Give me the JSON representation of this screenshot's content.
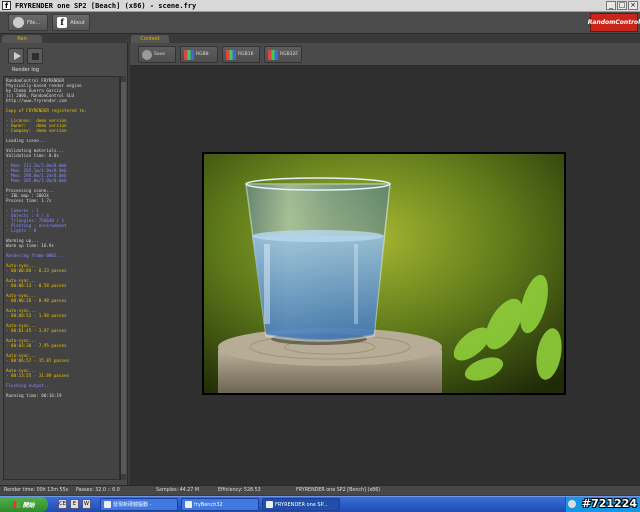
{
  "window": {
    "title": "FRYRENDER one SP2 [Beach] (x86) - scene.fry"
  },
  "toolbar": {
    "file_label": "File...",
    "about_label": "About",
    "brand": "RandomControl"
  },
  "left_tab": "Ren",
  "render_log_label": "Render log",
  "log_lines": [
    {
      "t": "RandomControl FRYRENDER",
      "c": "#d8d8d8"
    },
    {
      "t": "Physically-based render engine",
      "c": "#d8d8d8"
    },
    {
      "t": "by Chema Guerra Garcia",
      "c": "#d8d8d8"
    },
    {
      "t": "(c) 2006, RandomControl SLU",
      "c": "#d8d8d8"
    },
    {
      "t": "http://www.fryrender.com",
      "c": "#d8d8d8"
    },
    {
      "t": "",
      "c": "#d8d8d8"
    },
    {
      "t": "Copy of FRYRENDER registered to:",
      "c": "#e6c200"
    },
    {
      "t": "",
      "c": "#d8d8d8"
    },
    {
      "t": "- License:  demo version",
      "c": "#e6c200"
    },
    {
      "t": "- Owner:    demo version",
      "c": "#e6c200"
    },
    {
      "t": "- Company:  demo version",
      "c": "#e6c200"
    },
    {
      "t": "",
      "c": "#d8d8d8"
    },
    {
      "t": "Loading scene...",
      "c": "#d8d8d8"
    },
    {
      "t": "",
      "c": "#d8d8d8"
    },
    {
      "t": "Validating materials...",
      "c": "#d8d8d8"
    },
    {
      "t": "Validation time: 0.0s",
      "c": "#d8d8d8"
    },
    {
      "t": "",
      "c": "#d8d8d8"
    },
    {
      "t": "- Mem: 213.2m/3.0m/0.0mb",
      "c": "#8a8aff"
    },
    {
      "t": "- Mem: 205.1m/4.0m/0.0mb",
      "c": "#8a8aff"
    },
    {
      "t": "- Mem: 298.0m/1.2m/0.0mb",
      "c": "#8a8aff"
    },
    {
      "t": "- Mem: 205.0m/3.0m/0.0mb",
      "c": "#8a8aff"
    },
    {
      "t": "",
      "c": "#d8d8d8"
    },
    {
      "t": "Processing scene...",
      "c": "#d8d8d8"
    },
    {
      "t": "- IBL map : 2002k",
      "c": "#d8d8d8"
    },
    {
      "t": "Process time: 1.7s",
      "c": "#d8d8d8"
    },
    {
      "t": "",
      "c": "#d8d8d8"
    },
    {
      "t": "- Cameras : 1",
      "c": "#8a8aff"
    },
    {
      "t": "- Objects : 4 / 4",
      "c": "#8a8aff"
    },
    {
      "t": "- Triangles: 756648 / 1",
      "c": "#8a8aff"
    },
    {
      "t": "- Planting : environment",
      "c": "#8a8aff"
    },
    {
      "t": "- Lights : 0",
      "c": "#8a8aff"
    },
    {
      "t": "",
      "c": "#d8d8d8"
    },
    {
      "t": "Warming up...",
      "c": "#d8d8d8"
    },
    {
      "t": "Warm up time: 16.9s",
      "c": "#d8d8d8"
    },
    {
      "t": "",
      "c": "#d8d8d8"
    },
    {
      "t": "Rendering frame 0001...",
      "c": "#8a8aff"
    },
    {
      "t": "",
      "c": "#d8d8d8"
    },
    {
      "t": "Auto-sync...",
      "c": "#e6c200"
    },
    {
      "t": "- 00:00:06 - 0.23 passes",
      "c": "#e6c200"
    },
    {
      "t": "",
      "c": "#d8d8d8"
    },
    {
      "t": "Auto-sync...",
      "c": "#e6c200"
    },
    {
      "t": "- 00:00:13 - 0.58 passes",
      "c": "#e6c200"
    },
    {
      "t": "",
      "c": "#d8d8d8"
    },
    {
      "t": "Auto-sync...",
      "c": "#e6c200"
    },
    {
      "t": "- 00:00:26 - 0.98 passes",
      "c": "#e6c200"
    },
    {
      "t": "",
      "c": "#d8d8d8"
    },
    {
      "t": "Auto-sync...",
      "c": "#e6c200"
    },
    {
      "t": "- 00:00:52 - 1.98 passes",
      "c": "#e6c200"
    },
    {
      "t": "",
      "c": "#d8d8d8"
    },
    {
      "t": "Auto-sync...",
      "c": "#e6c200"
    },
    {
      "t": "- 00:01:45 - 3.97 passes",
      "c": "#e6c200"
    },
    {
      "t": "",
      "c": "#d8d8d8"
    },
    {
      "t": "Auto-sync...",
      "c": "#e6c200"
    },
    {
      "t": "- 00:03:30 - 7.95 passes",
      "c": "#e6c200"
    },
    {
      "t": "",
      "c": "#d8d8d8"
    },
    {
      "t": "Auto-sync...",
      "c": "#e6c200"
    },
    {
      "t": "- 00:06:57 - 15.87 passes",
      "c": "#e6c200"
    },
    {
      "t": "",
      "c": "#d8d8d8"
    },
    {
      "t": "Auto-sync...",
      "c": "#e6c200"
    },
    {
      "t": "- 00:13:55 - 31.89 passes",
      "c": "#e6c200"
    },
    {
      "t": "",
      "c": "#d8d8d8"
    },
    {
      "t": "Flushing output...",
      "c": "#8a8aff"
    },
    {
      "t": "",
      "c": "#d8d8d8"
    },
    {
      "t": "Running time: 00:16:19",
      "c": "#d8d8d8"
    }
  ],
  "context_tab": "Context",
  "context_buttons": {
    "save": "Save",
    "rgb1": "RGB8",
    "rgb2": "RGB16",
    "rgb3": "RGB32F"
  },
  "statusbar": {
    "render_time": "Render time: 00h 13m 55s",
    "passes": "Passes: 32.0 :: 6.0",
    "samples": "Samples: 44.27 M",
    "efficiency": "Efficiency: 528.53",
    "version": "FRYRENDER one SP2 [Bench] (x86)"
  },
  "taskbar": {
    "start_label": "開始",
    "quicklaunch": [
      "CE",
      "E",
      "W"
    ],
    "tasks": [
      "發現新硬體驅動 -",
      "fryBench32",
      "FRYRENDER one SP..."
    ]
  },
  "watermark": "#721224",
  "colors": {
    "accent_tab": "#e6b200",
    "brand_red": "#c8261a",
    "log_yellow": "#e6c200",
    "log_blue": "#8a8aff"
  }
}
